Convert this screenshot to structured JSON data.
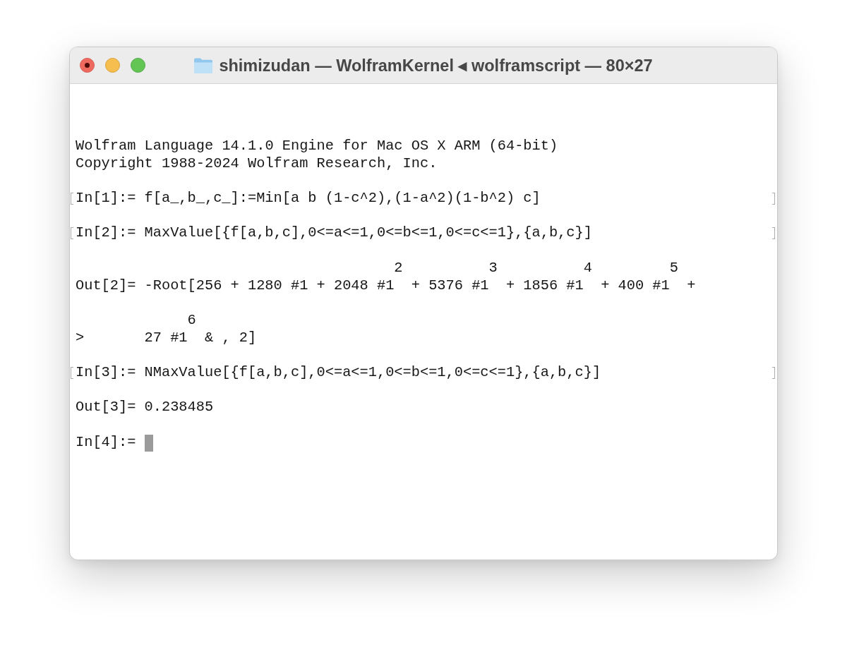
{
  "window": {
    "title": "shimizudan — WolframKernel ◂ wolframscript — 80×27",
    "process_running": true
  },
  "session": [
    {
      "kind": "banner",
      "lines": [
        "Wolfram Language 14.1.0 Engine for Mac OS X ARM (64-bit)",
        "Copyright 1988-2024 Wolfram Research, Inc."
      ]
    },
    {
      "kind": "input",
      "prompt": "In[1]:=",
      "text": "f[a_,b_,c_]:=Min[a b (1-c^2),(1-a^2)(1-b^2) c]",
      "marked": true,
      "cursor": false
    },
    {
      "kind": "input",
      "prompt": "In[2]:=",
      "text": "MaxValue[{f[a,b,c],0<=a<=1,0<=b<=1,0<=c<=1},{a,b,c}]",
      "marked": true,
      "cursor": false
    },
    {
      "kind": "output",
      "prompt": "Out[2]=",
      "text": "-Root[256 + 1280 #1 + 2048 #1$^{2}$ + 5376 #1$^{3}$ + 1856 #1$^{4}$ + 400 #1$^{5}$ +"
    },
    {
      "kind": "continuation",
      "prompt": ">",
      "text": "27 #1$^{6}$ & , 2]"
    },
    {
      "kind": "input",
      "prompt": "In[3]:=",
      "text": "NMaxValue[{f[a,b,c],0<=a<=1,0<=b<=1,0<=c<=1},{a,b,c}]",
      "marked": true,
      "cursor": false
    },
    {
      "kind": "output",
      "prompt": "Out[3]=",
      "text": "0.238485"
    },
    {
      "kind": "input",
      "prompt": "In[4]:=",
      "marked": false,
      "cursor": true
    }
  ]
}
